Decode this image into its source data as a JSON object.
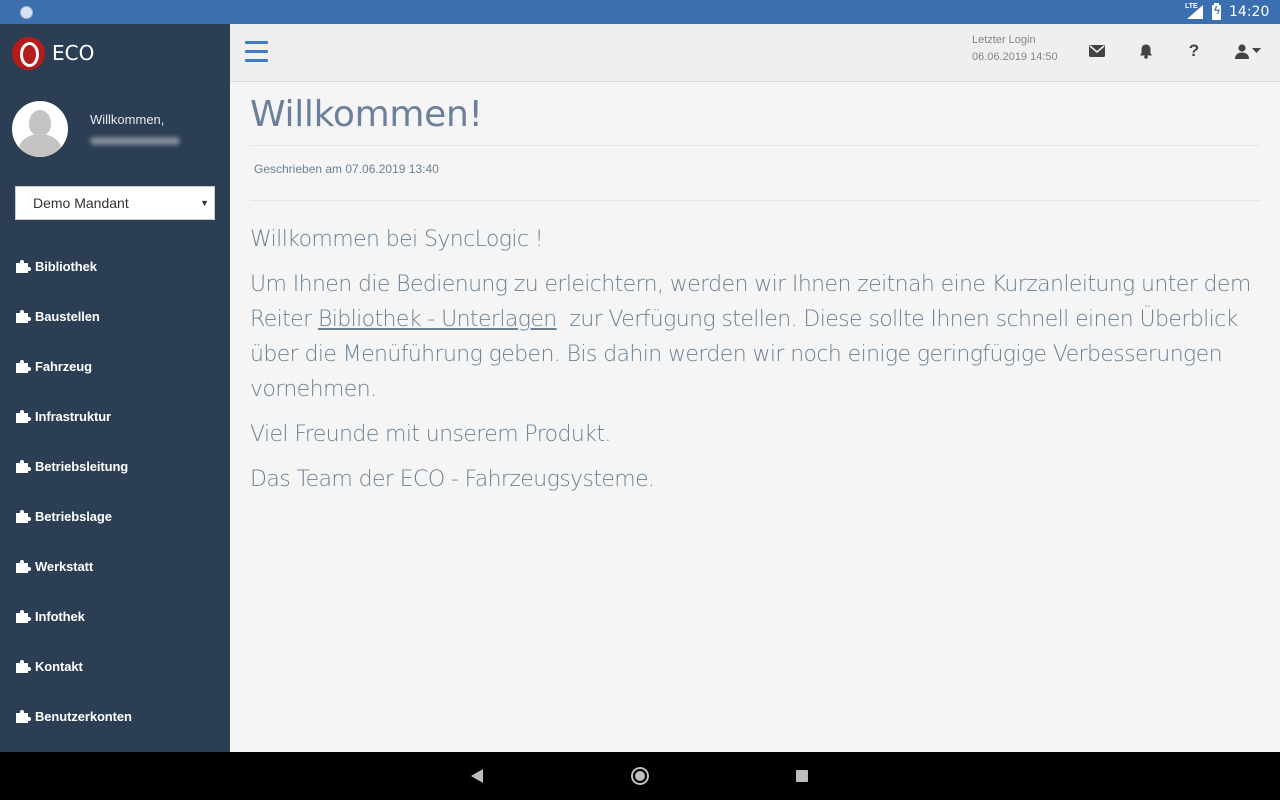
{
  "statusbar": {
    "network": "LTE",
    "time": "14:20"
  },
  "sidebar": {
    "brand": "ECO",
    "welcome": "Willkommen,",
    "mandant": "Demo Mandant",
    "items": [
      {
        "label": "Bibliothek"
      },
      {
        "label": "Baustellen"
      },
      {
        "label": "Fahrzeug"
      },
      {
        "label": "Infrastruktur"
      },
      {
        "label": "Betriebsleitung"
      },
      {
        "label": "Betriebslage"
      },
      {
        "label": "Werkstatt"
      },
      {
        "label": "Infothek"
      },
      {
        "label": "Kontakt"
      },
      {
        "label": "Benutzerkonten"
      }
    ]
  },
  "topbar": {
    "last_login_label": "Letzter Login",
    "last_login_value": "06.06.2019 14:50",
    "help_glyph": "?",
    "icons": [
      "menu-icon",
      "envelope-icon",
      "bell-icon",
      "help-icon",
      "user-icon",
      "caret-down-icon"
    ]
  },
  "main": {
    "title": "Willkommen!",
    "written": "Geschrieben am 07.06.2019 13:40",
    "p1": "Willkommen bei SyncLogic !",
    "p2_before": "Um Ihnen die Bedienung zu erleichtern, werden wir Ihnen zeitnah eine Kurzanleitung unter dem Reiter ",
    "p2_link": "Bibliothek - Unterlagen",
    "p2_after": "  zur Verfügung stellen. Diese sollte Ihnen schnell einen Überblick über die Menüführung geben. Bis dahin werden wir noch einige geringfügige Verbesserungen vornehmen.",
    "p3": "Viel Freunde mit unserem Produkt.",
    "p4": "Das Team der ECO - Fahrzeugsysteme."
  },
  "colors": {
    "statusbar": "#3b6fb0",
    "sidebar": "#2c3e54",
    "accent": "#3f7cc2",
    "text": "#6a8195"
  }
}
